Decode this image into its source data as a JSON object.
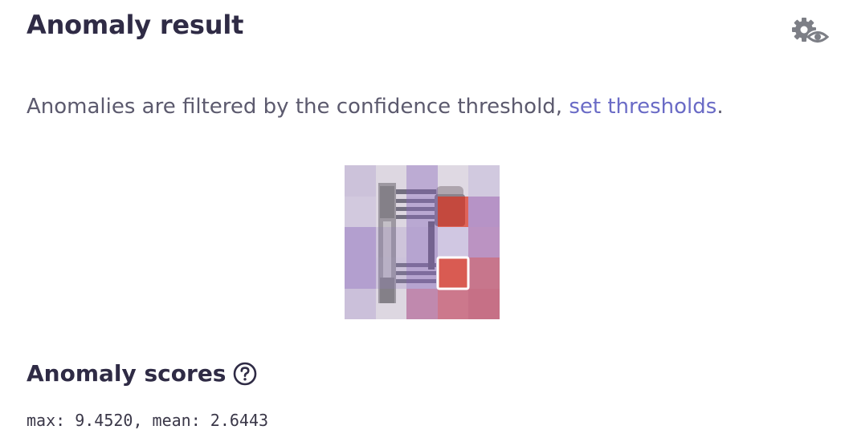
{
  "header": {
    "title": "Anomaly result",
    "settings_icon": "gear-eye-icon"
  },
  "description": {
    "text": "Anomalies are filtered by the confidence threshold, ",
    "link_label": "set thresholds",
    "suffix": "."
  },
  "heatmap": {
    "grid": [
      5,
      5
    ],
    "overlay_colors": {
      "low": "#9b7fc7",
      "high": "#d9463a"
    },
    "selected_cell": [
      3,
      3
    ]
  },
  "scores_section": {
    "title": "Anomaly scores",
    "help_icon": "question-circle-icon",
    "values_text": "max: 9.4520, mean: 2.6443"
  },
  "colors": {
    "text": "#2f2b45",
    "link": "#6a6bc6",
    "icon": "#7d7f86"
  }
}
